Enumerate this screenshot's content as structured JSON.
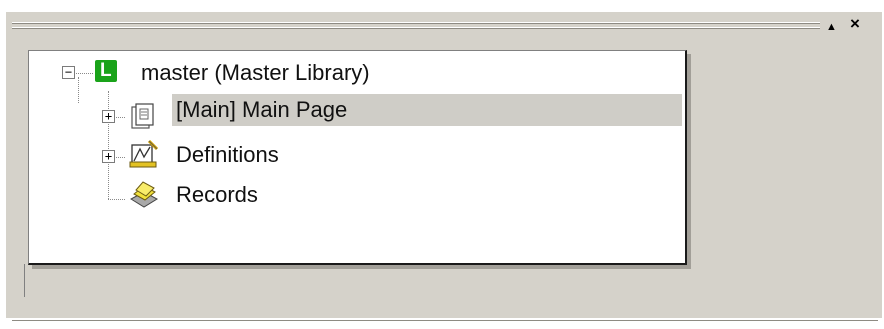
{
  "panel": {
    "pin_symbol": "▲",
    "close_symbol": "×"
  },
  "tree": {
    "root": {
      "label": "master (Master Library)",
      "expander": "−",
      "icon": "library-L-icon",
      "icon_letter": "L",
      "icon_color": "#1aa31a"
    },
    "children": [
      {
        "label": "[Main] Main Page",
        "expander": "+",
        "icon": "page-icon",
        "selected": true
      },
      {
        "label": "Definitions",
        "expander": "+",
        "icon": "definitions-icon"
      },
      {
        "label": "Records",
        "icon": "records-icon"
      }
    ]
  }
}
